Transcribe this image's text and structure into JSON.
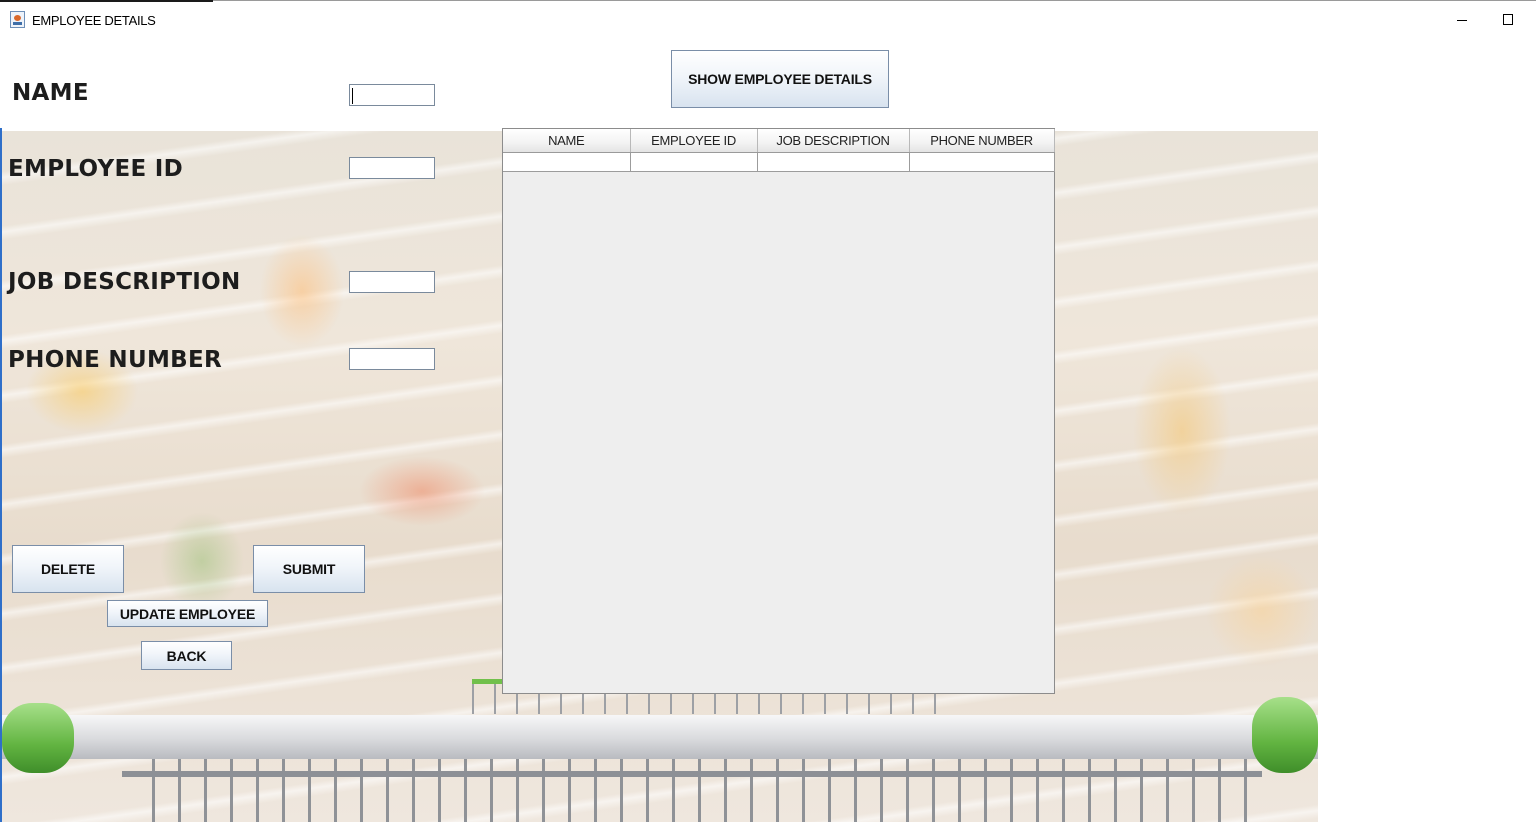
{
  "window": {
    "title": "EMPLOYEE DETAILS"
  },
  "form": {
    "name_label": "NAME",
    "employee_id_label": "EMPLOYEE ID",
    "job_description_label": "JOB DESCRIPTION",
    "phone_number_label": "PHONE NUMBER",
    "name_value": "",
    "employee_id_value": "",
    "job_description_value": "",
    "phone_number_value": ""
  },
  "buttons": {
    "show_details": "SHOW EMPLOYEE DETAILS",
    "delete": "DELETE",
    "submit": "SUBMIT",
    "update": "UPDATE EMPLOYEE",
    "back": "BACK"
  },
  "table": {
    "columns": [
      "NAME",
      "EMPLOYEE ID",
      "JOB DESCRIPTION",
      "PHONE NUMBER"
    ],
    "rows": [
      [
        "",
        "",
        "",
        ""
      ]
    ]
  },
  "colors": {
    "button_gradient_bottom": "#d8e3ef",
    "table_panel_bg": "#eeeeee",
    "cart_handle_green": "#62b441"
  },
  "icons": {
    "app": "java-cup-icon",
    "minimize": "minimize-icon",
    "maximize": "maximize-icon"
  }
}
